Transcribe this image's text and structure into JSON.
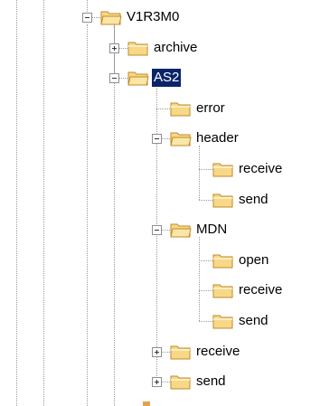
{
  "tree": {
    "rows": [
      {
        "label": "V1R3M0",
        "depth": 0,
        "toggle": "minus",
        "selected": false
      },
      {
        "label": "archive",
        "depth": 1,
        "toggle": "plus",
        "selected": false
      },
      {
        "label": "AS2",
        "depth": 1,
        "toggle": "minus",
        "selected": true
      },
      {
        "label": "error",
        "depth": 2,
        "toggle": "none",
        "selected": false
      },
      {
        "label": "header",
        "depth": 2,
        "toggle": "minus",
        "selected": false
      },
      {
        "label": "receive",
        "depth": 3,
        "toggle": "none",
        "selected": false
      },
      {
        "label": "send",
        "depth": 3,
        "toggle": "none",
        "selected": false
      },
      {
        "label": "MDN",
        "depth": 2,
        "toggle": "minus",
        "selected": false
      },
      {
        "label": "open",
        "depth": 3,
        "toggle": "none",
        "selected": false
      },
      {
        "label": "receive",
        "depth": 3,
        "toggle": "none",
        "selected": false
      },
      {
        "label": "send",
        "depth": 3,
        "toggle": "none",
        "selected": false
      },
      {
        "label": "receive",
        "depth": 2,
        "toggle": "plus",
        "selected": false
      },
      {
        "label": "send",
        "depth": 2,
        "toggle": "plus",
        "selected": false
      }
    ]
  },
  "colors": {
    "selection": "#0a246a",
    "folder_fill": "#f7d887",
    "folder_edge": "#c08a2a",
    "tree_line": "#9a9a9a"
  },
  "icons": {
    "folder": "folder-icon",
    "expand": "expand-plus-icon",
    "collapse": "collapse-minus-icon"
  }
}
